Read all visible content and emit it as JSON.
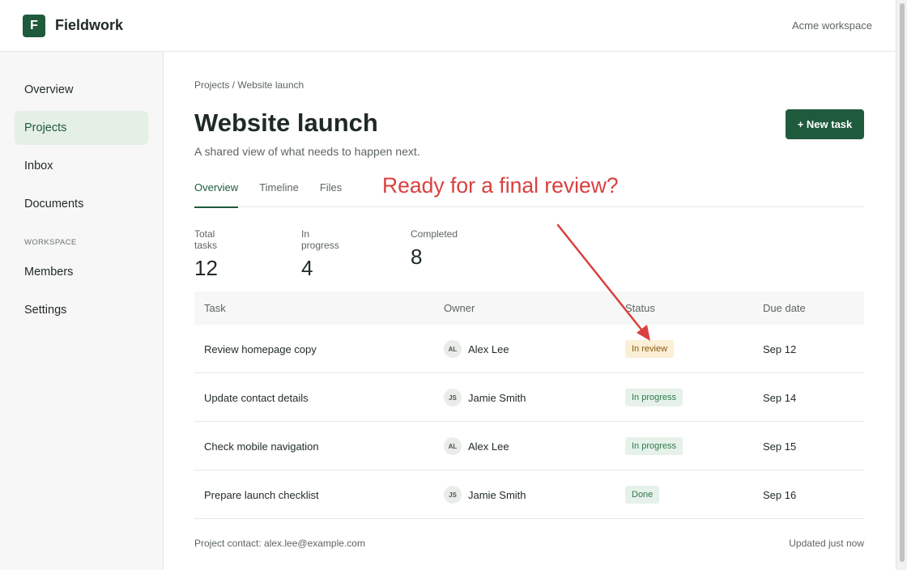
{
  "app": {
    "logo_letter": "F",
    "name": "Fieldwork",
    "workspace": "Acme workspace"
  },
  "sidebar": {
    "items": [
      {
        "label": "Overview",
        "active": false
      },
      {
        "label": "Projects",
        "active": true
      },
      {
        "label": "Inbox",
        "active": false
      },
      {
        "label": "Documents",
        "active": false
      }
    ],
    "section_label": "WORKSPACE",
    "workspace_items": [
      {
        "label": "Members"
      },
      {
        "label": "Settings"
      }
    ]
  },
  "main": {
    "breadcrumb": "Projects / Website launch",
    "title": "Website launch",
    "subtitle": "A shared view of what needs to happen next.",
    "new_task_label": "+ New task",
    "tabs": [
      {
        "label": "Overview",
        "active": true
      },
      {
        "label": "Timeline",
        "active": false
      },
      {
        "label": "Files",
        "active": false
      }
    ],
    "stats": [
      {
        "label": "Total tasks",
        "value": "12"
      },
      {
        "label": "In progress",
        "value": "4"
      },
      {
        "label": "Completed",
        "value": "8"
      }
    ],
    "table": {
      "headers": {
        "task": "Task",
        "owner": "Owner",
        "status": "Status",
        "due": "Due date"
      },
      "rows": [
        {
          "task": "Review homepage copy",
          "initials": "AL",
          "owner": "Alex Lee",
          "status": "In review",
          "due": "Sep 12"
        },
        {
          "task": "Update contact details",
          "initials": "JS",
          "owner": "Jamie Smith",
          "status": "In progress",
          "due": "Sep 14"
        },
        {
          "task": "Check mobile navigation",
          "initials": "AL",
          "owner": "Alex Lee",
          "status": "In progress",
          "due": "Sep 15"
        },
        {
          "task": "Prepare launch checklist",
          "initials": "JS",
          "owner": "Jamie Smith",
          "status": "Done",
          "due": "Sep 16"
        }
      ]
    },
    "footer_contact": "Project contact: alex.lee@example.com",
    "footer_updated": "Updated just now"
  },
  "annotation": {
    "text": "Ready for a final review?",
    "color": "#d94040"
  },
  "colors": {
    "brand": "#1f5a3d",
    "review_badge_bg": "#fbefd5",
    "progress_badge_bg": "#e6f1e9"
  }
}
